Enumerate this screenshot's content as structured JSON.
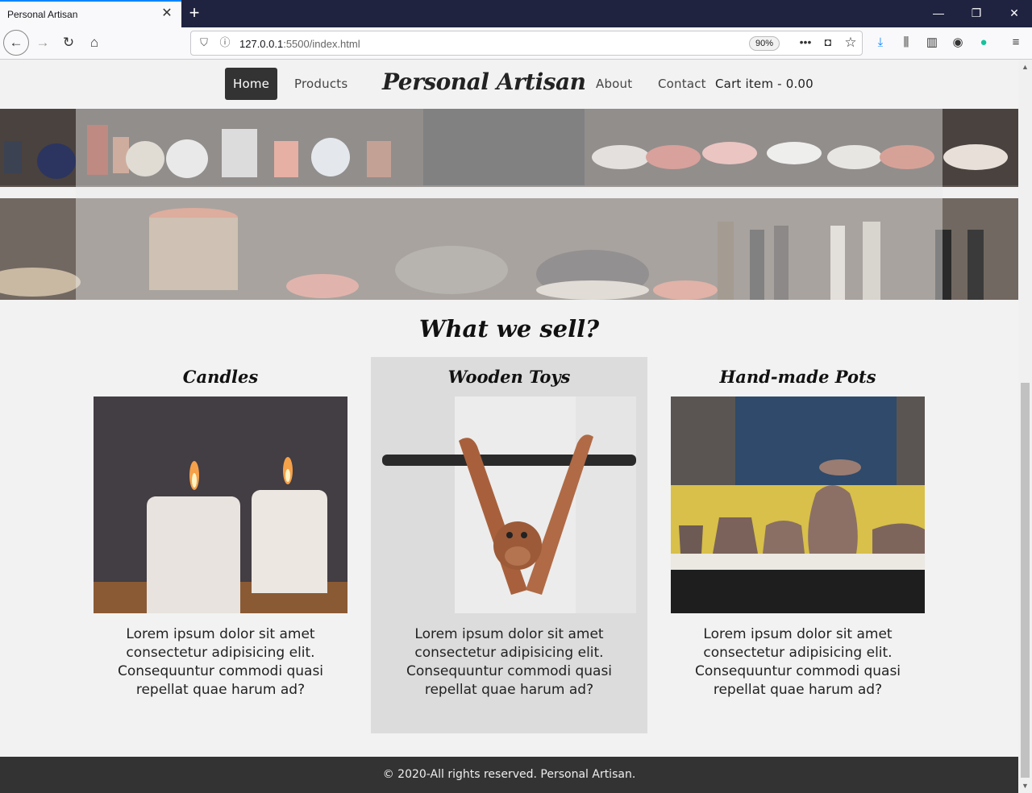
{
  "browser": {
    "tab_title": "Personal Artisan",
    "url_host": "127.0.0.1",
    "url_rest": ":5500/index.html",
    "zoom": "90%"
  },
  "nav": {
    "home": "Home",
    "products": "Products",
    "brand": "Personal Artisan",
    "about": "About",
    "contact": "Contact",
    "cart": "Cart item - 0.00"
  },
  "section": {
    "title": "What we sell?"
  },
  "cards": [
    {
      "title": "Candles",
      "text": "Lorem ipsum dolor sit amet consectetur adipisicing elit. Consequuntur commodi quasi repellat quae harum ad?"
    },
    {
      "title": "Wooden Toys",
      "text": "Lorem ipsum dolor sit amet consectetur adipisicing elit. Consequuntur commodi quasi repellat quae harum ad?"
    },
    {
      "title": "Hand-made Pots",
      "text": "Lorem ipsum dolor sit amet consectetur adipisicing elit. Consequuntur commodi quasi repellat quae harum ad?"
    }
  ],
  "footer": {
    "text": "© 2020-All rights reserved. Personal Artisan."
  },
  "colors": {
    "browser_dark": "#1f2340",
    "nav_active_bg": "#333333",
    "footer_bg": "#333333",
    "highlight_card": "#dcdcdc",
    "accent_blue": "#0a84ff"
  }
}
